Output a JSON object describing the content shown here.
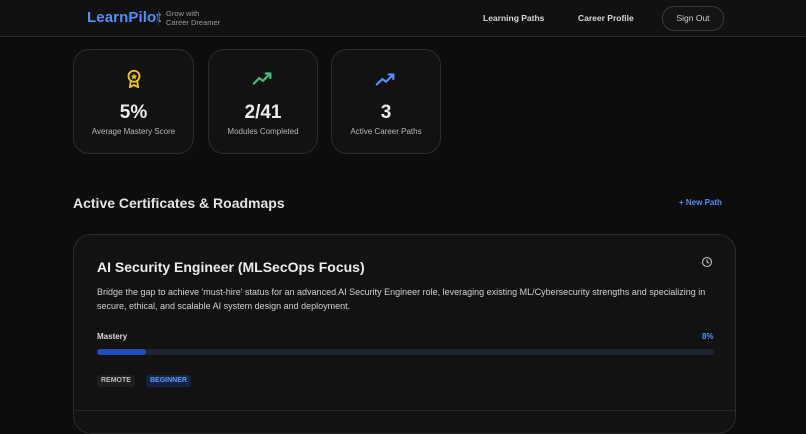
{
  "header": {
    "brand": "LearnPilot",
    "tagline_line1": "Grow with",
    "tagline_line2": "Career Dreamer",
    "nav": {
      "learning_paths": "Learning Paths",
      "career_profile": "Career Profile",
      "sign_out": "Sign Out"
    }
  },
  "stats": [
    {
      "icon": "award-icon",
      "value": "5%",
      "label": "Average Mastery Score",
      "color": "#f5c518"
    },
    {
      "icon": "trend-up-icon",
      "value": "2/41",
      "label": "Modules Completed",
      "color": "#3fbf7a"
    },
    {
      "icon": "trend-up-icon",
      "value": "3",
      "label": "Active Career Paths",
      "color": "#4f8ff7"
    }
  ],
  "section": {
    "title": "Active Certificates & Roadmaps",
    "new_path": "+ New Path"
  },
  "roadmap": {
    "title": "AI Security Engineer (MLSecOps Focus)",
    "description": "Bridge the gap to achieve 'must-hire' status for an advanced AI Security Engineer role, leveraging existing ML/Cybersecurity strengths and specializing in secure, ethical, and scalable AI system design and deployment.",
    "mastery_label": "Mastery",
    "mastery_pct": "8%",
    "mastery_value": 8,
    "tags": [
      "REMOTE",
      "BEGINNER"
    ]
  },
  "colors": {
    "accent": "#4f8ff7",
    "background": "#0d0d0d"
  }
}
